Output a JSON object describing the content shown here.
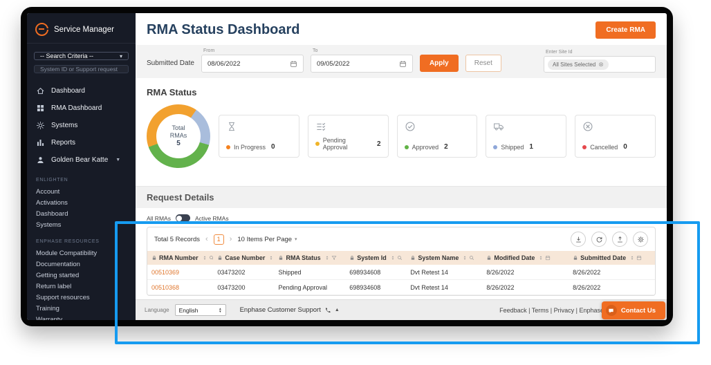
{
  "app": {
    "accent_color": "#f06d22",
    "highlight_color": "#169bf0"
  },
  "sidebar": {
    "logo_text": "Service Manager",
    "search_criteria_value": "-- Search Criteria --",
    "search_placeholder": "System ID or Support request",
    "nav": [
      {
        "label": "Dashboard",
        "icon": "home-icon"
      },
      {
        "label": "RMA Dashboard",
        "icon": "grid-icon"
      },
      {
        "label": "Systems",
        "icon": "sun-icon"
      },
      {
        "label": "Reports",
        "icon": "bar-chart-icon"
      },
      {
        "label": "Golden Bear Katte",
        "icon": "user-icon"
      }
    ],
    "sections": [
      {
        "title": "ENLIGHTEN",
        "items": [
          "Account",
          "Activations",
          "Dashboard",
          "Systems"
        ]
      },
      {
        "title": "ENPHASE RESOURCES",
        "items": [
          "Module Compatibility",
          "Documentation",
          "Getting started",
          "Return label",
          "Support resources",
          "Training",
          "Warranty"
        ]
      }
    ]
  },
  "header": {
    "title": "RMA Status Dashboard",
    "create_button": "Create RMA"
  },
  "filters": {
    "submitted_date_label": "Submitted Date",
    "from_label": "From",
    "from_value": "08/06/2022",
    "to_label": "To",
    "to_value": "09/05/2022",
    "apply_label": "Apply",
    "reset_label": "Reset",
    "site_label": "Enter Site Id",
    "site_chip": "All Sites Selected"
  },
  "rma_status": {
    "section_title": "RMA Status",
    "donut_center": {
      "line1": "Total",
      "line2": "RMAs",
      "value": "5"
    },
    "cards": [
      {
        "label": "In Progress",
        "count": "0",
        "color": "#f5821f",
        "icon": "hourglass-icon"
      },
      {
        "label": "Pending Approval",
        "count": "2",
        "color": "#f0b429",
        "icon": "checklist-icon"
      },
      {
        "label": "Approved",
        "count": "2",
        "color": "#61b346",
        "icon": "check-circle-icon"
      },
      {
        "label": "Shipped",
        "count": "1",
        "color": "#8fa7d9",
        "icon": "truck-icon"
      },
      {
        "label": "Cancelled",
        "count": "0",
        "color": "#e5484d",
        "icon": "x-circle-icon"
      }
    ]
  },
  "request_details": {
    "section_title": "Request Details",
    "toggle_left": "All RMAs",
    "toggle_right": "Active RMAs",
    "total_records": "Total 5 Records",
    "page": "1",
    "items_per_page": "10 Items Per Page",
    "columns": [
      {
        "label": "RMA Number",
        "icon": "search-icon"
      },
      {
        "label": "Case Number",
        "icon": "search-icon"
      },
      {
        "label": "RMA Status",
        "icon": "filter-icon"
      },
      {
        "label": "System Id",
        "icon": "search-icon"
      },
      {
        "label": "System Name",
        "icon": "search-icon"
      },
      {
        "label": "Modified Date",
        "icon": "calendar-icon"
      },
      {
        "label": "Submitted Date",
        "icon": "calendar-icon"
      }
    ],
    "rows": [
      [
        "00510369",
        "03473202",
        "Shipped",
        "698934608",
        "Dvt Retest 14",
        "8/26/2022",
        "8/26/2022"
      ],
      [
        "00510368",
        "03473200",
        "Pending Approval",
        "698934608",
        "Dvt Retest 14",
        "8/26/2022",
        "8/26/2022"
      ]
    ]
  },
  "footer": {
    "language_label": "Language",
    "language_value": "English",
    "support_text": "Enphase Customer Support",
    "links": "Feedback | Terms | Privacy | Enphase",
    "contact_button": "Contact Us"
  },
  "chart_data": {
    "type": "pie",
    "title": "Total RMAs",
    "total": 5,
    "labels": [
      "In Progress",
      "Pending Approval",
      "Approved",
      "Shipped",
      "Cancelled"
    ],
    "values": [
      0,
      2,
      2,
      1,
      0
    ],
    "colors": [
      "#f5821f",
      "#f0b429",
      "#61b346",
      "#8fa7d9",
      "#e5484d"
    ],
    "legend_position": "right"
  }
}
